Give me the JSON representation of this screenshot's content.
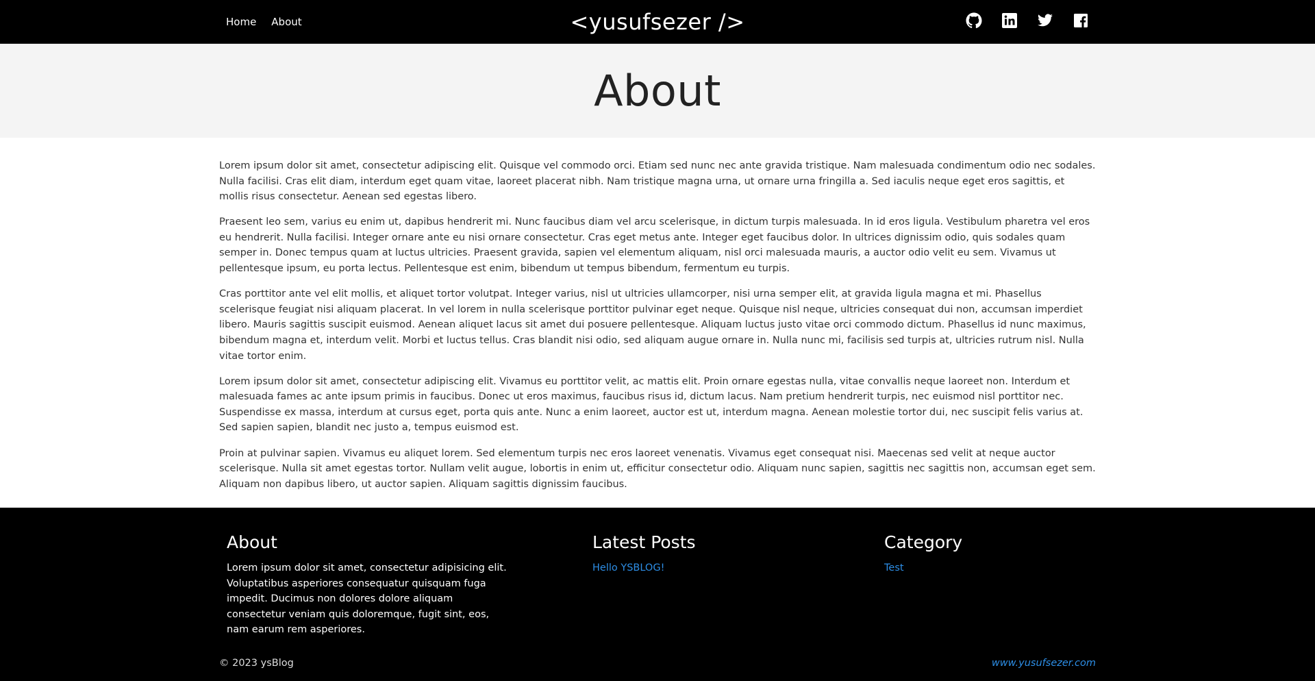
{
  "nav": {
    "links": [
      "Home",
      "About"
    ],
    "brand": "<yusufsezer />",
    "social": [
      "github-icon",
      "linkedin-icon",
      "twitter-icon",
      "facebook-icon"
    ]
  },
  "hero": {
    "title": "About"
  },
  "content": {
    "paragraphs": [
      "Lorem ipsum dolor sit amet, consectetur adipiscing elit. Quisque vel commodo orci. Etiam sed nunc nec ante gravida tristique. Nam malesuada condimentum odio nec sodales. Nulla facilisi. Cras elit diam, interdum eget quam vitae, laoreet placerat nibh. Nam tristique magna urna, ut ornare urna fringilla a. Sed iaculis neque eget eros sagittis, et mollis risus consectetur. Aenean sed egestas libero.",
      "Praesent leo sem, varius eu enim ut, dapibus hendrerit mi. Nunc faucibus diam vel arcu scelerisque, in dictum turpis malesuada. In id eros ligula. Vestibulum pharetra vel eros eu hendrerit. Nulla facilisi. Integer ornare ante eu nisi ornare consectetur. Cras eget metus ante. Integer eget faucibus dolor. In ultrices dignissim odio, quis sodales quam semper in. Donec tempus quam at luctus ultricies. Praesent gravida, sapien vel elementum aliquam, nisl orci malesuada mauris, a auctor odio velit eu sem. Vivamus ut pellentesque ipsum, eu porta lectus. Pellentesque est enim, bibendum ut tempus bibendum, fermentum eu turpis.",
      "Cras porttitor ante vel elit mollis, et aliquet tortor volutpat. Integer varius, nisl ut ultricies ullamcorper, nisi urna semper elit, at gravida ligula magna et mi. Phasellus scelerisque feugiat nisi aliquam placerat. In vel lorem in nulla scelerisque porttitor pulvinar eget neque. Quisque nisl neque, ultricies consequat dui non, accumsan imperdiet libero. Mauris sagittis suscipit euismod. Aenean aliquet lacus sit amet dui posuere pellentesque. Aliquam luctus justo vitae orci commodo dictum. Phasellus id nunc maximus, bibendum magna et, interdum velit. Morbi et luctus tellus. Cras blandit nisi odio, sed aliquam augue ornare in. Nulla nunc mi, facilisis sed turpis at, ultricies rutrum nisl. Nulla vitae tortor enim.",
      "Lorem ipsum dolor sit amet, consectetur adipiscing elit. Vivamus eu porttitor velit, ac mattis elit. Proin ornare egestas nulla, vitae convallis neque laoreet non. Interdum et malesuada fames ac ante ipsum primis in faucibus. Donec ut eros maximus, faucibus risus id, dictum lacus. Nam pretium hendrerit turpis, nec euismod nisl porttitor nec. Suspendisse ex massa, interdum at cursus eget, porta quis ante. Nunc a enim laoreet, auctor est ut, interdum magna. Aenean molestie tortor dui, nec suscipit felis varius at. Sed sapien sapien, blandit nec justo a, tempus euismod est.",
      "Proin at pulvinar sapien. Vivamus eu aliquet lorem. Sed elementum turpis nec eros laoreet venenatis. Vivamus eget consequat nisi. Maecenas sed velit at neque auctor scelerisque. Nulla sit amet egestas tortor. Nullam velit augue, lobortis in enim ut, efficitur consectetur odio. Aliquam nunc sapien, sagittis nec sagittis non, accumsan eget sem. Aliquam non dapibus libero, ut auctor sapien. Aliquam sagittis dignissim faucibus."
    ]
  },
  "footer": {
    "about": {
      "title": "About",
      "text": "Lorem ipsum dolor sit amet, consectetur adipisicing elit. Voluptatibus asperiores consequatur quisquam fuga impedit. Ducimus non dolores dolore aliquam consectetur veniam quis doloremque, fugit sint, eos, nam earum rem asperiores."
    },
    "latest_posts": {
      "title": "Latest Posts",
      "items": [
        "Hello YSBLOG!"
      ]
    },
    "category": {
      "title": "Category",
      "items": [
        "Test"
      ]
    },
    "copyright": "© 2023 ysBlog",
    "site_link": "www.yusufsezer.com",
    "link_color": "#2d8ee6"
  }
}
